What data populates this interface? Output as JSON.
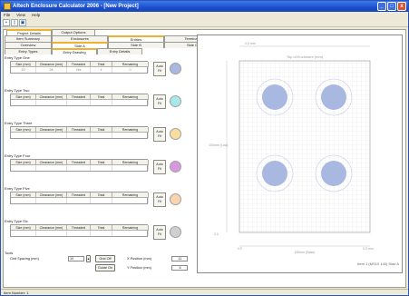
{
  "window": {
    "title": "Altech Enclosure Calculator 2006 - [New Project]",
    "controls": [
      "_",
      "□",
      "x"
    ]
  },
  "menu": [
    "File",
    "View",
    "Help"
  ],
  "toolbar": [
    "+",
    "▯",
    "▣"
  ],
  "tabs": {
    "level1": [
      "Project Details",
      "Output Options"
    ],
    "level2": [
      "Item Summary",
      "Enclosures",
      "Entries",
      "Terminals",
      "Other Items"
    ],
    "level3": [
      "Overview",
      "Side A",
      "Side B",
      "Side C",
      "Side D"
    ],
    "level4": [
      "Entry Types",
      "Entry Drawing",
      "Entry Details"
    ]
  },
  "columns": [
    "Size (mm)",
    "Clearance (mm)",
    "Threaded",
    "Total",
    "Remaining"
  ],
  "entry_types": [
    {
      "title": "Entry Type One",
      "values": [
        "20",
        "28",
        "Yes",
        "4",
        "0"
      ],
      "color": "#a8b8e0"
    },
    {
      "title": "Entry Type Two",
      "values": [
        "",
        "",
        "",
        "",
        ""
      ],
      "color": "#a8e8e8"
    },
    {
      "title": "Entry Type Three",
      "values": [
        "",
        "",
        "",
        "",
        ""
      ],
      "color": "#f8dca0"
    },
    {
      "title": "Entry Type Four",
      "values": [
        "",
        "",
        "",
        "",
        ""
      ],
      "color": "#d898e0"
    },
    {
      "title": "Entry Type Five",
      "values": [
        "",
        "",
        "",
        "",
        ""
      ],
      "color": "#f8d4b0"
    },
    {
      "title": "Entry Type Six",
      "values": [
        "",
        "",
        "",
        "",
        ""
      ],
      "color": "#d0d0d0"
    }
  ],
  "autofit_label": "Auto Fit",
  "tools": {
    "title": "Tools",
    "grid_spacing_label": "Grid Spacing (mm)",
    "grid_spacing_value": "10",
    "grid_off": "Grid Off",
    "guide_on": "Guide On",
    "x_label": "X Position (mm)",
    "x_value": "11",
    "y_label": "Y Position (mm)",
    "y_value": "6"
  },
  "preview": {
    "top_label": "Top of Enclosure (mm)",
    "width_top": "0.0 mm",
    "left_label": "100mm (Low)",
    "bottom_label": "150mm (Base)",
    "x_min": "0.0",
    "x_max": "0.0 mm",
    "y_min": "0.0",
    "caption": "Item 1 (MS10 140) Side A",
    "hole_color": "#a8b8e0"
  },
  "status": "Item Number: 1"
}
